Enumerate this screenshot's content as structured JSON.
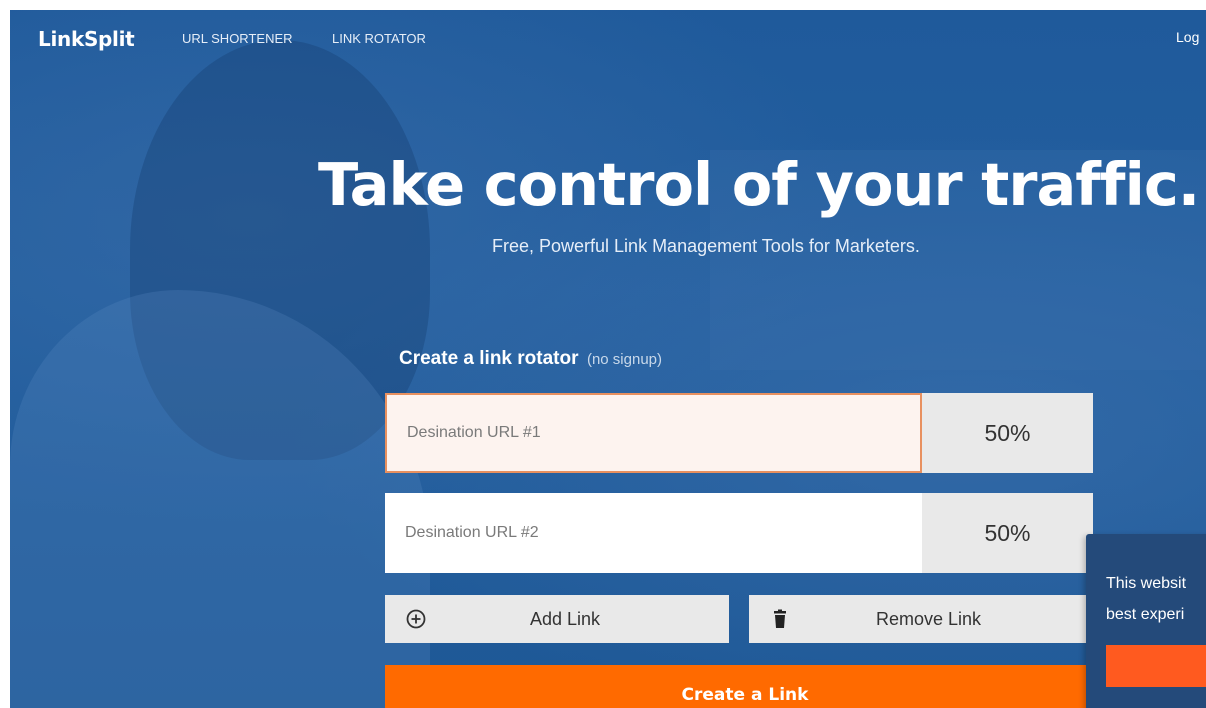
{
  "nav": {
    "logo": "LinkSplit",
    "links": [
      "URL SHORTENER",
      "LINK ROTATOR"
    ],
    "login": "Log"
  },
  "hero": {
    "headline": "Take control of your traffic.",
    "subheadline": "Free, Powerful Link Management Tools for Marketers."
  },
  "form": {
    "title": "Create a link rotator",
    "title_note": "(no signup)",
    "rows": [
      {
        "placeholder": "Desination URL #1",
        "percent": "50%"
      },
      {
        "placeholder": "Desination URL #2",
        "percent": "50%"
      }
    ],
    "add_label": "Add Link",
    "add_icon": "plus-circle-icon",
    "remove_label": "Remove Link",
    "remove_icon": "trash-icon",
    "submit_label": "Create a Link"
  },
  "cookie": {
    "line1": "This websit",
    "line2": "best experi"
  },
  "colors": {
    "background": "#1f5a9b",
    "accent": "#ff6a00",
    "input_focus_border": "#e8905f",
    "cookie_bg": "#244a7a"
  }
}
